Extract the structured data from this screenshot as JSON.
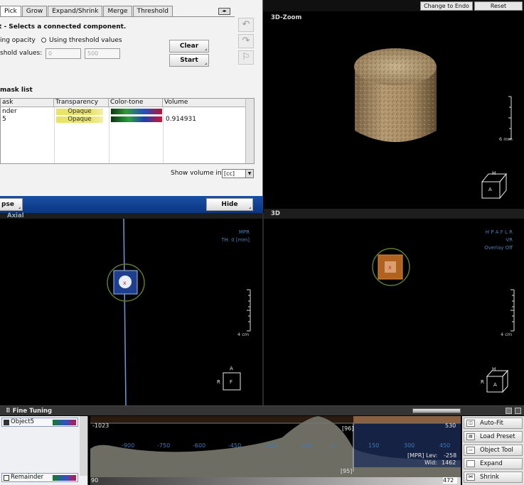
{
  "dialog": {
    "tabs": [
      {
        "label": "Pick",
        "active": true
      },
      {
        "label": "Grow",
        "active": false
      },
      {
        "label": "Expand/Shrink",
        "active": false
      },
      {
        "label": "Merge",
        "active": false
      },
      {
        "label": "Threshold",
        "active": false
      }
    ],
    "description": "- Selects a connected component.",
    "radio_opacity": "ing opacity",
    "radio_threshold": "Using threshold values",
    "threshold_label": "shold values:",
    "threshold_min": "0",
    "threshold_max": "500",
    "clear_label": "Clear",
    "start_label": "Start",
    "mask_list_title": "mask list",
    "columns": [
      "ask",
      "Transparency",
      "Color-tone",
      "Volume"
    ],
    "rows": [
      {
        "mask": "nder",
        "transparency": "Opaque",
        "volume": ""
      },
      {
        "mask": "5",
        "transparency": "Opaque",
        "volume": "0.914931"
      }
    ],
    "show_volume_label": "Show volume in",
    "show_volume_unit": "[cc]",
    "collapse_label": "pse",
    "hide_label": "Hide"
  },
  "top_buttons": {
    "change_to_endo": "Change to Endo",
    "reset": "Reset"
  },
  "viewports": {
    "zoom3d": {
      "title": "3D-Zoom",
      "scale": "6 mm",
      "cube_top": "H",
      "cube_face": "A"
    },
    "axial": {
      "title": "Axial",
      "info1": "MPR",
      "info2": "TH: 0 [mm]",
      "scale": "4 cm",
      "orient_top": "A",
      "orient_left": "R",
      "orient_face": "F"
    },
    "view3d": {
      "title": "3D",
      "info1": "H P A F L R",
      "info2": "VR",
      "info3": "Overlay Off",
      "scale": "4 cm",
      "cube_top": "H",
      "cube_left": "R",
      "cube_face": "A"
    }
  },
  "fine_tuning": {
    "title": "Fine Tuning",
    "objects": [
      {
        "label": "Object5",
        "checked": true
      },
      {
        "label": "Remainder",
        "checked": false
      }
    ],
    "histogram": {
      "left_value": "-1023",
      "right_value": "530",
      "top_marker": "[96]",
      "bottom_marker": "[95]",
      "ticks": [
        "-900",
        "-750",
        "-600",
        "-450",
        "-300",
        "-150",
        "0",
        "150",
        "300",
        "450"
      ],
      "lev_label": "[MPR] Lev:",
      "lev_value": "-258",
      "wid_label": "Wid:",
      "wid_value": "1462",
      "axis_left": "90",
      "axis_right": "472"
    },
    "tools": [
      "Auto-Fit",
      "Load Preset",
      "Object Tool",
      "Expand",
      "Shrink"
    ]
  },
  "colors": {
    "dialog_blue": "#1a4fa5",
    "info_blue": "#4a7fb5",
    "object_orange": "#c8782a",
    "circle_green": "#6a8a3a"
  }
}
